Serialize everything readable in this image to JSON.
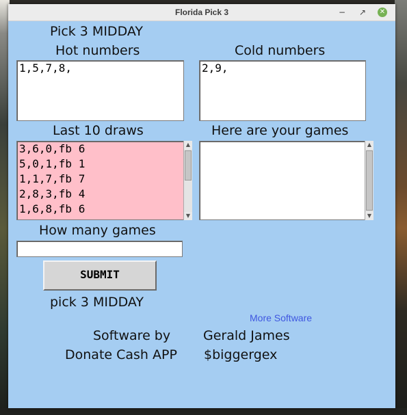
{
  "window": {
    "title": "Florida Pick 3"
  },
  "header": {
    "game_title": "Pick 3 MIDDAY"
  },
  "hot": {
    "label": "Hot numbers",
    "value": "1,5,7,8,"
  },
  "cold": {
    "label": "Cold numbers",
    "value": "2,9,"
  },
  "draws": {
    "label": "Last 10 draws",
    "items": [
      "3,6,0,fb 6",
      "5,0,1,fb 1",
      "1,1,7,fb 7",
      "2,8,3,fb 4",
      "1,6,8,fb 6"
    ]
  },
  "games": {
    "label": "Here are your games",
    "value": ""
  },
  "how_many": {
    "label": "How many games",
    "value": ""
  },
  "submit": {
    "label": "SUBMIT"
  },
  "footer": {
    "game_name": "pick 3 MIDDAY",
    "more_software": "More Software",
    "software_by_label": "Software by",
    "author": "Gerald James",
    "donate_label": "Donate Cash APP",
    "cashtag": "$biggergex"
  },
  "colors": {
    "window_bg": "#a5cdf2",
    "draws_bg": "#ffbfc9",
    "link": "#3f57e0",
    "close_button": "#77b255"
  },
  "icons": [
    "minimize-icon",
    "maximize-icon",
    "close-icon"
  ]
}
